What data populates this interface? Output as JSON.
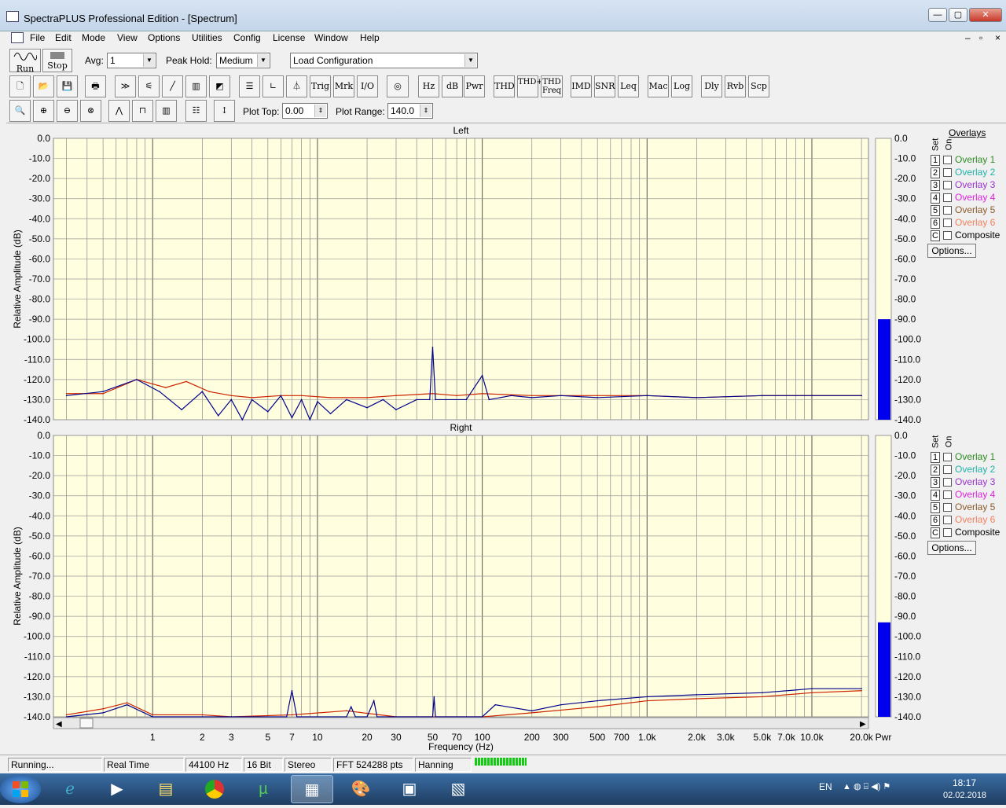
{
  "window": {
    "title": "SpectraPLUS Professional Edition - [Spectrum]",
    "btn_min": "—",
    "btn_max": "▢",
    "btn_close": "✕"
  },
  "menu": [
    "File",
    "Edit",
    "Mode",
    "View",
    "Options",
    "Utilities",
    "Config",
    "License",
    "Window",
    "Help"
  ],
  "toolbar1": {
    "run": "Run",
    "stop": "Stop",
    "avg_label": "Avg:",
    "avg_value": "1",
    "peak_label": "Peak Hold:",
    "peak_value": "Medium",
    "config_value": "Load Configuration"
  },
  "toolbar2": [
    "Trig",
    "Mrk",
    "I/O",
    "Hz",
    "dB",
    "Pwr",
    "THD",
    "THD+N",
    "THD Freq",
    "IMD",
    "SNR",
    "Leq",
    "Mac",
    "Log",
    "Dly",
    "Rvb",
    "Scp"
  ],
  "toolbar3": {
    "plot_top_label": "Plot Top:",
    "plot_top_value": "0.00",
    "plot_range_label": "Plot Range:",
    "plot_range_value": "140.0"
  },
  "overlays_title": "Overlays",
  "overlays_set_label": "Set",
  "overlays_on_label": "On",
  "overlays": [
    {
      "set": "1",
      "label": "Overlay 1",
      "color": "#2e8b22"
    },
    {
      "set": "2",
      "label": "Overlay 2",
      "color": "#20b2aa"
    },
    {
      "set": "3",
      "label": "Overlay 3",
      "color": "#9932cc"
    },
    {
      "set": "4",
      "label": "Overlay 4",
      "color": "#dd22dd"
    },
    {
      "set": "5",
      "label": "Overlay 5",
      "color": "#8b5a2b"
    },
    {
      "set": "6",
      "label": "Overlay 6",
      "color": "#f08060"
    },
    {
      "set": "C",
      "label": "Composite",
      "color": "#000000"
    }
  ],
  "options_button": "Options...",
  "chart_data": [
    {
      "type": "line",
      "title": "Left",
      "ylabel": "Relative Amplitude (dB)",
      "xlabel": "Frequency (Hz)",
      "xscale": "log",
      "xlim": [
        0.25,
        22050
      ],
      "ylim": [
        -140,
        0
      ],
      "yticks": [
        "0.0",
        "-10.0",
        "-20.0",
        "-30.0",
        "-40.0",
        "-50.0",
        "-60.0",
        "-70.0",
        "-80.0",
        "-90.0",
        "-100.0",
        "-110.0",
        "-120.0",
        "-130.0",
        "-140.0"
      ],
      "meter_label": "Pwr",
      "meter_level_db": -90,
      "series": [
        {
          "color": "#cc2200",
          "points": [
            [
              0.3,
              -127
            ],
            [
              0.5,
              -127
            ],
            [
              0.8,
              -120
            ],
            [
              1.2,
              -124
            ],
            [
              1.6,
              -121
            ],
            [
              2.2,
              -126
            ],
            [
              3,
              -128
            ],
            [
              4,
              -129
            ],
            [
              6,
              -128
            ],
            [
              8,
              -128
            ],
            [
              12,
              -129
            ],
            [
              20,
              -129
            ],
            [
              30,
              -128
            ],
            [
              50,
              -127
            ],
            [
              70,
              -128
            ],
            [
              100,
              -127
            ],
            [
              200,
              -128
            ],
            [
              500,
              -128
            ],
            [
              1000,
              -128
            ],
            [
              2000,
              -129
            ],
            [
              5000,
              -128
            ],
            [
              10000,
              -128
            ],
            [
              20000,
              -128
            ]
          ]
        },
        {
          "color": "#00008b",
          "points": [
            [
              0.3,
              -128
            ],
            [
              0.5,
              -126
            ],
            [
              0.8,
              -120
            ],
            [
              1.1,
              -126
            ],
            [
              1.5,
              -135
            ],
            [
              2,
              -126
            ],
            [
              2.5,
              -138
            ],
            [
              3,
              -130
            ],
            [
              3.5,
              -140
            ],
            [
              4,
              -130
            ],
            [
              5,
              -136
            ],
            [
              6,
              -128
            ],
            [
              7,
              -139
            ],
            [
              8,
              -130
            ],
            [
              9,
              -140
            ],
            [
              10,
              -131
            ],
            [
              12,
              -137
            ],
            [
              15,
              -130
            ],
            [
              20,
              -134
            ],
            [
              25,
              -130
            ],
            [
              30,
              -135
            ],
            [
              40,
              -130
            ],
            [
              48,
              -130
            ],
            [
              50,
              -104
            ],
            [
              52,
              -130
            ],
            [
              60,
              -130
            ],
            [
              80,
              -130
            ],
            [
              100,
              -118
            ],
            [
              110,
              -130
            ],
            [
              150,
              -128
            ],
            [
              200,
              -129
            ],
            [
              300,
              -128
            ],
            [
              500,
              -129
            ],
            [
              1000,
              -128
            ],
            [
              2000,
              -129
            ],
            [
              5000,
              -128
            ],
            [
              10000,
              -128
            ],
            [
              20000,
              -128
            ]
          ]
        }
      ]
    },
    {
      "type": "line",
      "title": "Right",
      "ylabel": "Relative Amplitude (dB)",
      "xlabel": "Frequency (Hz)",
      "xscale": "log",
      "xlim": [
        0.25,
        22050
      ],
      "ylim": [
        -140,
        0
      ],
      "yticks": [
        "0.0",
        "-10.0",
        "-20.0",
        "-30.0",
        "-40.0",
        "-50.0",
        "-60.0",
        "-70.0",
        "-80.0",
        "-90.0",
        "-100.0",
        "-110.0",
        "-120.0",
        "-130.0",
        "-140.0"
      ],
      "meter_label": "Pwr",
      "meter_level_db": -93,
      "xticks": [
        "1",
        "2",
        "3",
        "5",
        "7",
        "10",
        "20",
        "30",
        "50",
        "70",
        "100",
        "200",
        "300",
        "500",
        "700",
        "1.0k",
        "2.0k",
        "3.0k",
        "5.0k",
        "7.0k",
        "10.0k",
        "20.0k"
      ],
      "series": [
        {
          "color": "#cc2200",
          "points": [
            [
              0.3,
              -139
            ],
            [
              0.5,
              -136
            ],
            [
              0.7,
              -133
            ],
            [
              1,
              -139
            ],
            [
              2,
              -139
            ],
            [
              3,
              -140
            ],
            [
              7,
              -139
            ],
            [
              15,
              -137
            ],
            [
              30,
              -140
            ],
            [
              100,
              -140
            ],
            [
              200,
              -138
            ],
            [
              500,
              -135
            ],
            [
              1000,
              -132
            ],
            [
              2000,
              -131
            ],
            [
              5000,
              -130
            ],
            [
              10000,
              -128
            ],
            [
              20000,
              -127
            ]
          ]
        },
        {
          "color": "#00008b",
          "points": [
            [
              0.3,
              -140
            ],
            [
              0.5,
              -138
            ],
            [
              0.7,
              -134
            ],
            [
              1,
              -140
            ],
            [
              2,
              -140
            ],
            [
              3,
              -140
            ],
            [
              6.5,
              -140
            ],
            [
              7,
              -127
            ],
            [
              7.5,
              -140
            ],
            [
              15,
              -140
            ],
            [
              16,
              -135
            ],
            [
              17,
              -140
            ],
            [
              20,
              -140
            ],
            [
              22,
              -132
            ],
            [
              23,
              -140
            ],
            [
              50,
              -140
            ],
            [
              51,
              -130
            ],
            [
              52,
              -140
            ],
            [
              100,
              -140
            ],
            [
              120,
              -134
            ],
            [
              200,
              -137
            ],
            [
              300,
              -134
            ],
            [
              500,
              -132
            ],
            [
              1000,
              -130
            ],
            [
              2000,
              -129
            ],
            [
              5000,
              -128
            ],
            [
              10000,
              -126
            ],
            [
              20000,
              -126
            ]
          ]
        }
      ]
    }
  ],
  "status": [
    "Running...",
    "Real Time",
    "44100 Hz",
    "16 Bit",
    "Stereo",
    "FFT 524288 pts",
    "Hanning"
  ],
  "tray": {
    "lang": "EN",
    "time": "18:17",
    "date": "02.02.2018"
  }
}
